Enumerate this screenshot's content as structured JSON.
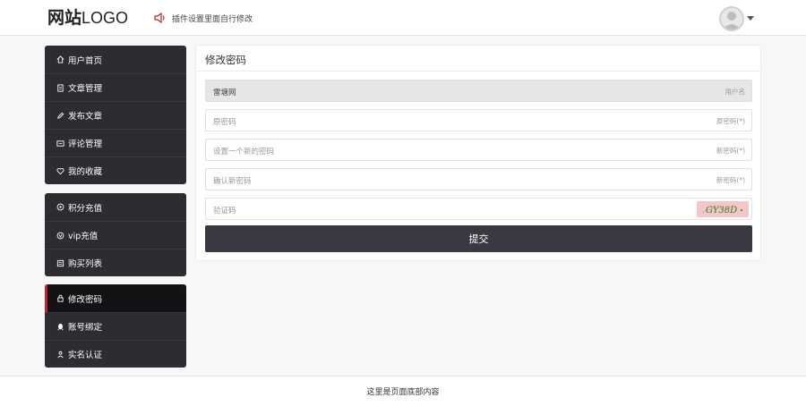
{
  "header": {
    "logo_cn": "网站",
    "logo_en": "LOGO",
    "notice": "插件设置里面自行修改"
  },
  "sidebar": {
    "groups": [
      {
        "items": [
          {
            "label": "用户首页",
            "icon": "home-icon"
          },
          {
            "label": "文章管理",
            "icon": "document-icon"
          },
          {
            "label": "发布文章",
            "icon": "pencil-icon"
          },
          {
            "label": "评论管理",
            "icon": "comment-icon"
          },
          {
            "label": "我的收藏",
            "icon": "heart-icon"
          }
        ]
      },
      {
        "items": [
          {
            "label": "积分充值",
            "icon": "coin-icon"
          },
          {
            "label": "vip充值",
            "icon": "vip-icon"
          },
          {
            "label": "购买列表",
            "icon": "list-icon"
          }
        ]
      },
      {
        "items": [
          {
            "label": "修改密码",
            "icon": "lock-icon",
            "active": true
          },
          {
            "label": "账号绑定",
            "icon": "qq-icon"
          },
          {
            "label": "实名认证",
            "icon": "id-card-icon"
          }
        ]
      }
    ]
  },
  "main": {
    "title": "修改密码",
    "fields": [
      {
        "value": "雷塘网",
        "label": "用户名",
        "readonly": true
      },
      {
        "placeholder": "原密码",
        "label": "原密码(*)"
      },
      {
        "placeholder": "设置一个新的密码",
        "label": "新密码(*)"
      },
      {
        "placeholder": "确认新密码",
        "label": "新密码(*)"
      },
      {
        "placeholder": "验证码",
        "captcha_text": "GY38D"
      }
    ],
    "submit_label": "提交"
  },
  "footer": {
    "text": "这里是页面底部内容"
  },
  "colors": {
    "sidebar_bg": "#2e2b31",
    "active_bg": "#141215",
    "accent": "#c0232a",
    "button_bg": "#3a3840"
  }
}
